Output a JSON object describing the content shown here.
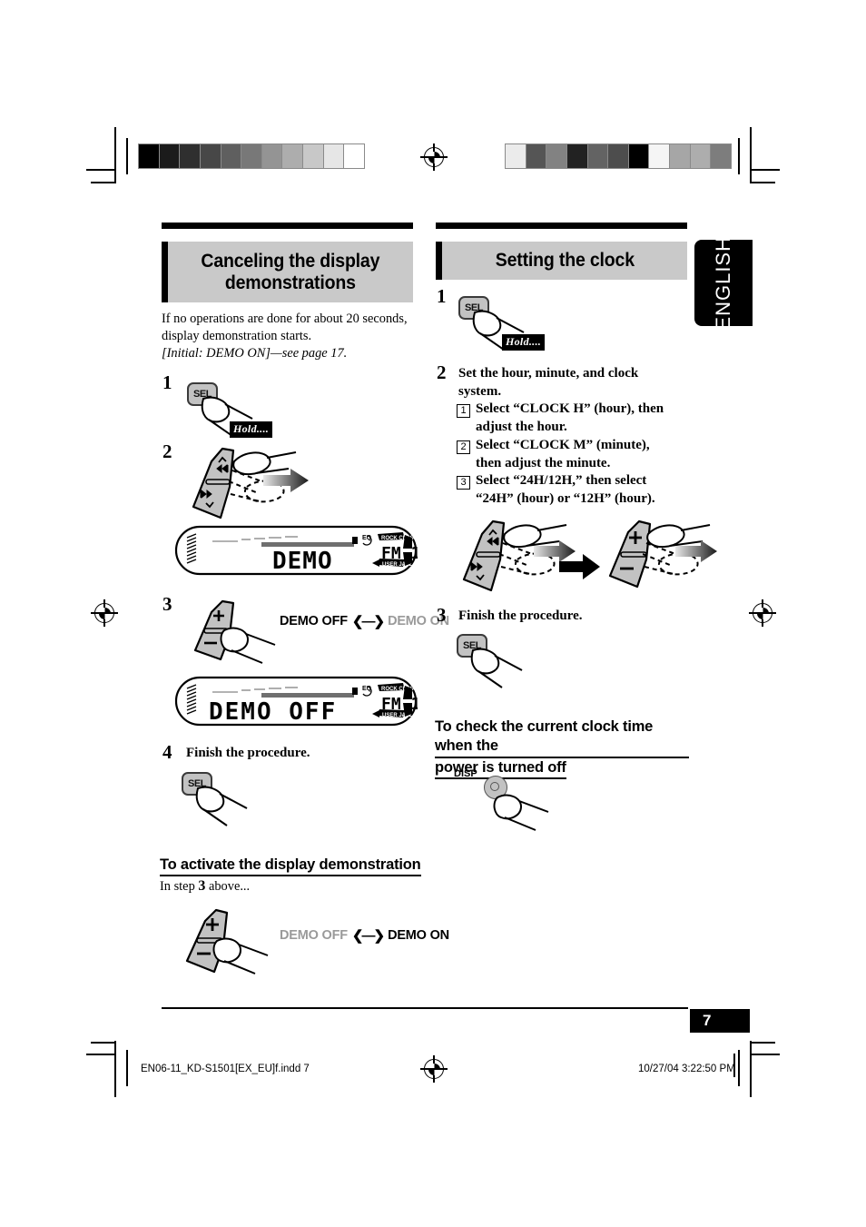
{
  "document": {
    "language_tab": "ENGLISH",
    "page_number": "7",
    "footer_filename": "EN06-11_KD-S1501[EX_EU]f.indd   7",
    "footer_timestamp": "10/27/04   3:22:50 PM"
  },
  "left_column": {
    "section_title": "Canceling the display demonstrations",
    "section_title_line1": "Canceling the display",
    "section_title_line2": "demonstrations",
    "intro_line1": "If no operations are done for about 20 seconds,",
    "intro_line2": "display demonstration starts.",
    "intro_line3": "[Initial: DEMO ON]—see page 17.",
    "steps": [
      {
        "num": "1",
        "text": "",
        "key": "SEL",
        "hold_label": "Hold...."
      },
      {
        "num": "2",
        "text": "",
        "key": "track-rocker"
      },
      {
        "num": "3",
        "text": "",
        "key": "plus-minus-rocker"
      },
      {
        "num": "4",
        "text": "Finish the procedure.",
        "key": "SEL"
      }
    ],
    "lcd_1": {
      "main_text": "DEMO",
      "band_text": "FM 1",
      "eq_label": "EQ",
      "preset_top_left": "ROCK",
      "preset_top_right": "CLASSIC",
      "preset_bottom_left": "USER",
      "preset_bottom_right": "JAZZ",
      "preset_side_top": "POPS",
      "preset_side_bottom": "HIP HOP"
    },
    "lcd_2": {
      "main_text": "DEMO OFF",
      "band_text": "FM 1",
      "eq_label": "EQ",
      "preset_top_left": "ROCK",
      "preset_top_right": "CLASSIC",
      "preset_bottom_left": "USER",
      "preset_bottom_right": "JAZZ",
      "preset_side_top": "POPS",
      "preset_side_bottom": "HIP HOP"
    },
    "toggle_step3": {
      "left": "DEMO OFF",
      "right": "DEMO ON",
      "active": "left"
    },
    "subsection_title": "To activate the display demonstration",
    "subsection_body_pre": "In step ",
    "subsection_body_num": "3",
    "subsection_body_post": " above...",
    "toggle_bottom": {
      "left": "DEMO OFF",
      "right": "DEMO ON",
      "active": "right"
    }
  },
  "right_column": {
    "section_title": "Setting the clock",
    "steps": [
      {
        "num": "1",
        "text": "",
        "key": "SEL",
        "hold_label": "Hold...."
      },
      {
        "num": "2",
        "text_line1": "Set the hour, minute, and clock",
        "text_line2": "system."
      },
      {
        "num": "3",
        "text": "Finish the procedure.",
        "key": "SEL"
      }
    ],
    "substeps": [
      {
        "num": "1",
        "line1": "Select “CLOCK H” (hour), then",
        "line2": "adjust the hour."
      },
      {
        "num": "2",
        "line1": "Select “CLOCK M” (minute),",
        "line2": "then adjust the minute."
      },
      {
        "num": "3",
        "line1": "Select “24H/12H,” then select",
        "line2": "“24H” (hour) or “12H” (hour)."
      }
    ],
    "subsection_title_line1": "To check the current clock time when the",
    "subsection_title_line2": "power is turned off",
    "disp_label": "DISP"
  },
  "colors": {
    "header_bg": "#c9c9c9",
    "key_gray": "#c2c2c2",
    "inactive_text": "#9a9a9a",
    "black": "#000000"
  },
  "print_marks": {
    "wedge_left_steps": [
      "#000000",
      "#1b1b1b",
      "#2f2f2f",
      "#474747",
      "#5f5f5f",
      "#787878",
      "#949494",
      "#adadad",
      "#c8c8c8",
      "#e6e6e6",
      "#ffffff"
    ],
    "wedge_right_steps": [
      "#ebebeb",
      "#555555",
      "#828282",
      "#222222",
      "#636363",
      "#4d4d4d",
      "#000000",
      "#f5f5f5",
      "#a6a6a6",
      "#adadad",
      "#7d7d7d"
    ]
  }
}
